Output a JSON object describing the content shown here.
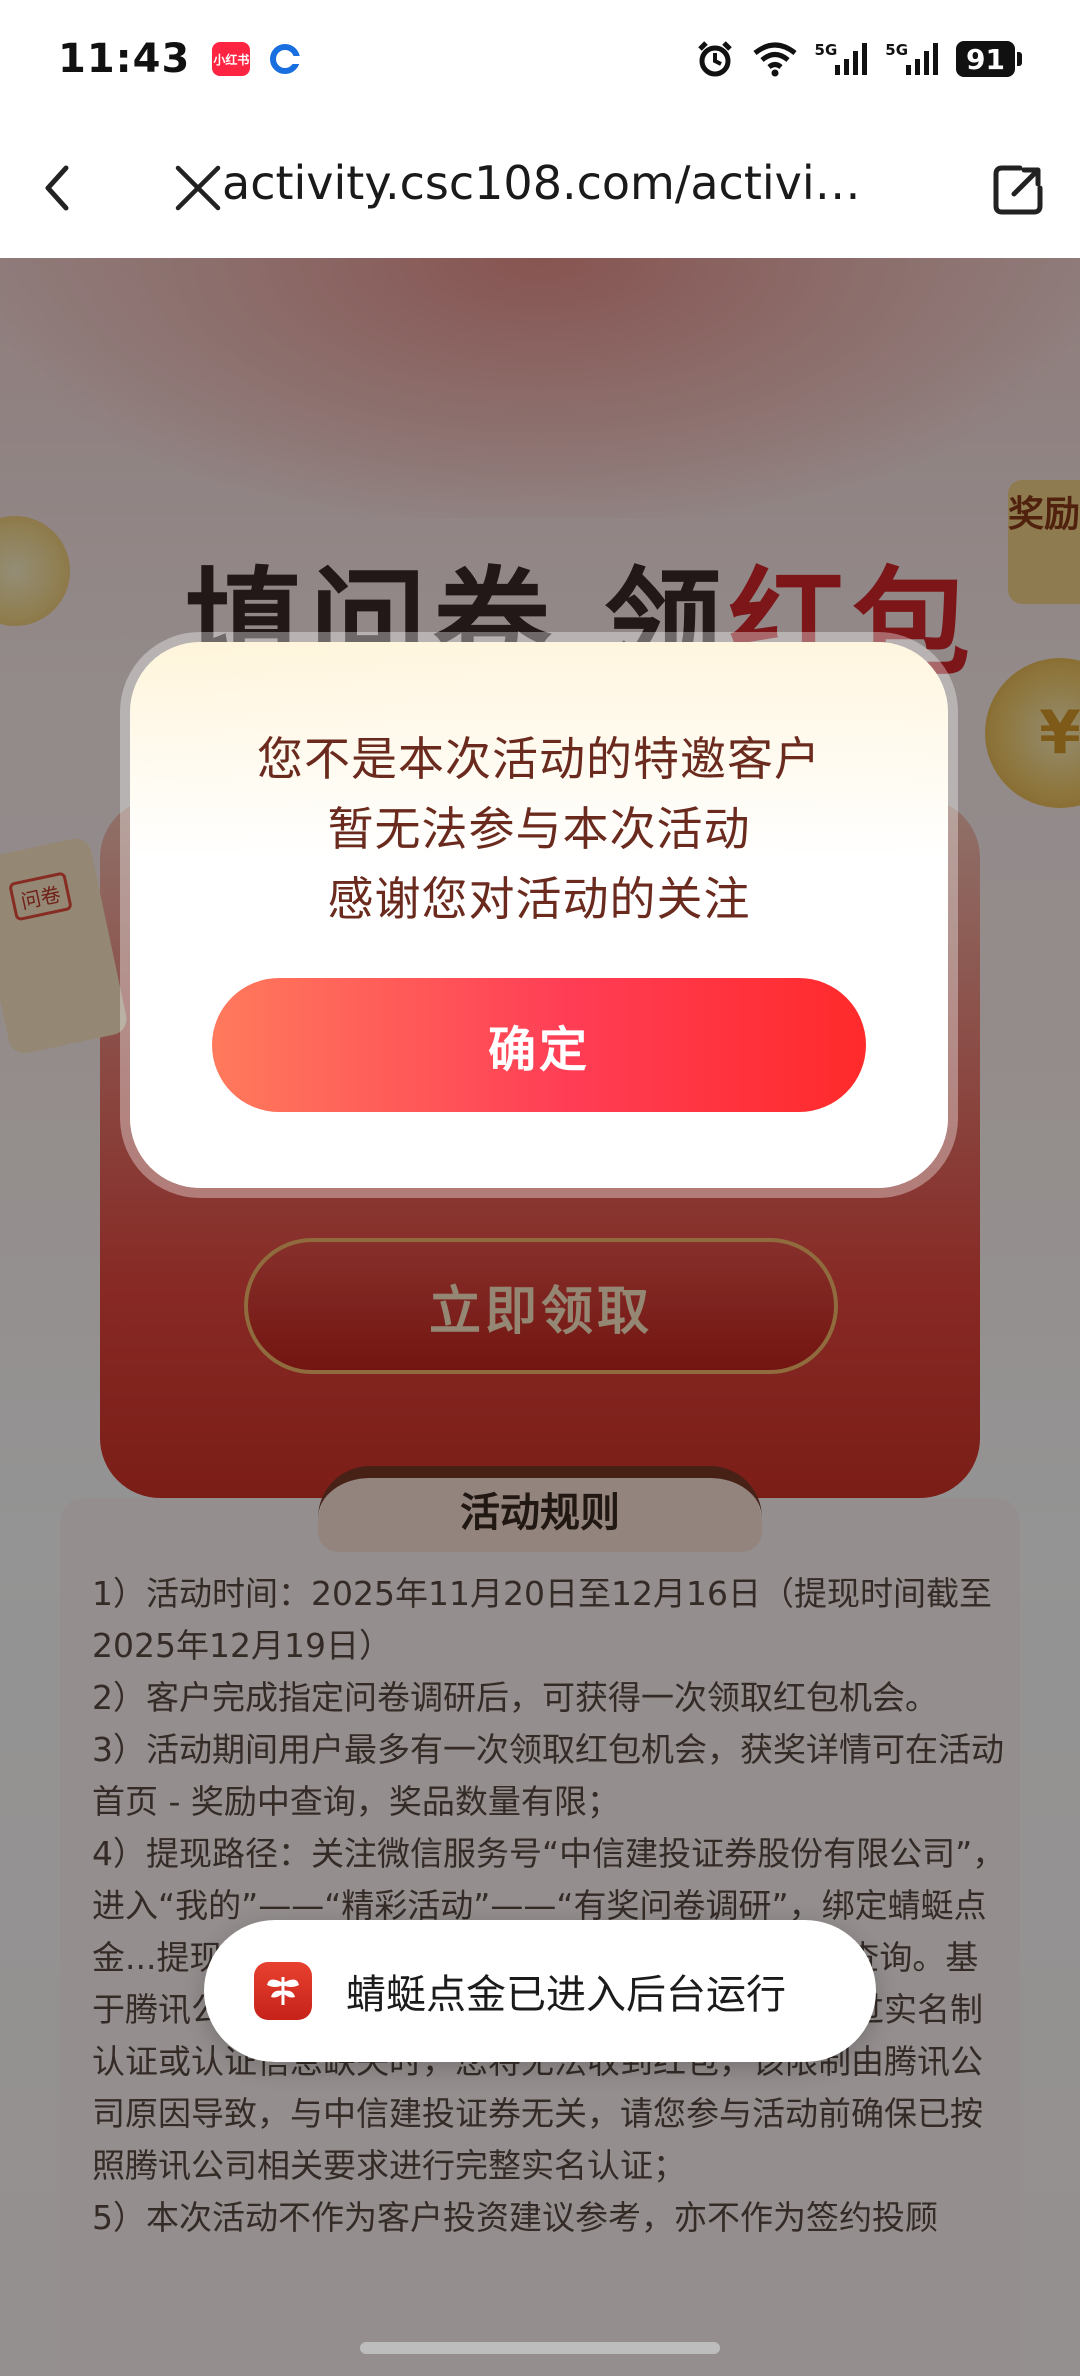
{
  "status_bar": {
    "time": "11:43",
    "app_badge_label": "小红书",
    "signal_1_label": "5G",
    "signal_2_label": "5G",
    "battery": "91"
  },
  "browser": {
    "url": "activity.csc108.com/activity..."
  },
  "hero": {
    "title_part1": "填问卷 领",
    "title_part2": "红包",
    "reward_tab": "奖励",
    "scroll_tag": "问卷",
    "cta_label": "立即领取"
  },
  "rules": {
    "title": "活动规则",
    "lines": [
      "1）活动时间：2025年11月20日至12月16日（提现时间截至2025年12月19日）",
      "2）客户完成指定问卷调研后，可获得一次领取红包机会。",
      "3）活动期间用户最多有一次领取红包机会，获奖详情可在活动首页 - 奖励中查询，奖品数量有限；",
      "4）提现路径：关注微信服务号“中信建投证券股份有限公司”，进入“我的”——“精彩活动”——“有奖问卷调研”，绑定蜻蜓点金...提现后中奖红包...——钱包 —— 账单 菜单进行查询。基于腾讯公司关于微信实名认证要求及限制，用户未经过实名制认证或认证信息缺失时，您将无法收到红包，该限制由腾讯公司原因导致，与中信建投证券无关，请您参与活动前确保已按照腾讯公司相关要求进行完整实名认证；",
      "5）本次活动不作为客户投资建议参考，亦不作为签约投顾"
    ]
  },
  "modal": {
    "message_line1": "您不是本次活动的特邀客户",
    "message_line2": "暂无法参与本次活动",
    "message_line3": "感谢您对活动的关注",
    "confirm_label": "确定"
  },
  "toast": {
    "text": "蜻蜓点金已进入后台运行"
  }
}
